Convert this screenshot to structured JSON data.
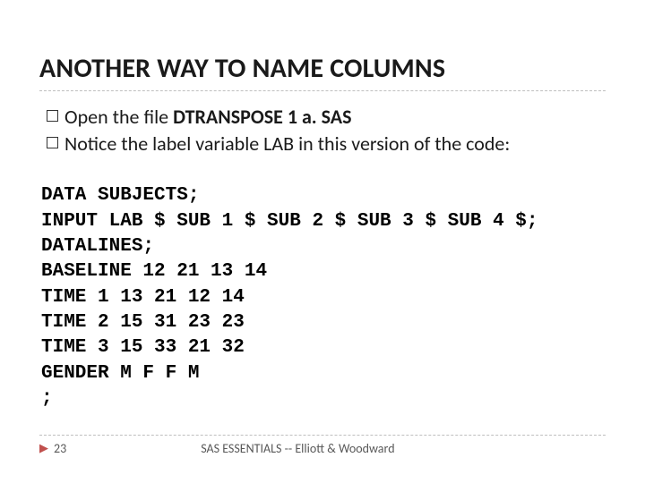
{
  "title": "ANOTHER WAY TO NAME COLUMNS",
  "bullets": [
    {
      "prefix": "Open the file ",
      "strong": "DTRANSPOSE 1 a. SAS",
      "suffix": ""
    },
    {
      "prefix": "Notice the label variable LAB in this version of the code:",
      "strong": "",
      "suffix": ""
    }
  ],
  "code": "DATA SUBJECTS;\nINPUT LAB $ SUB 1 $ SUB 2 $ SUB 3 $ SUB 4 $;\nDATALINES;\nBASELINE 12 21 13 14\nTIME 1 13 21 12 14\nTIME 2 15 31 23 23\nTIME 3 15 33 21 32\nGENDER M F F M\n;",
  "footer": {
    "page": "23",
    "text": "SAS ESSENTIALS -- Elliott & Woodward"
  }
}
